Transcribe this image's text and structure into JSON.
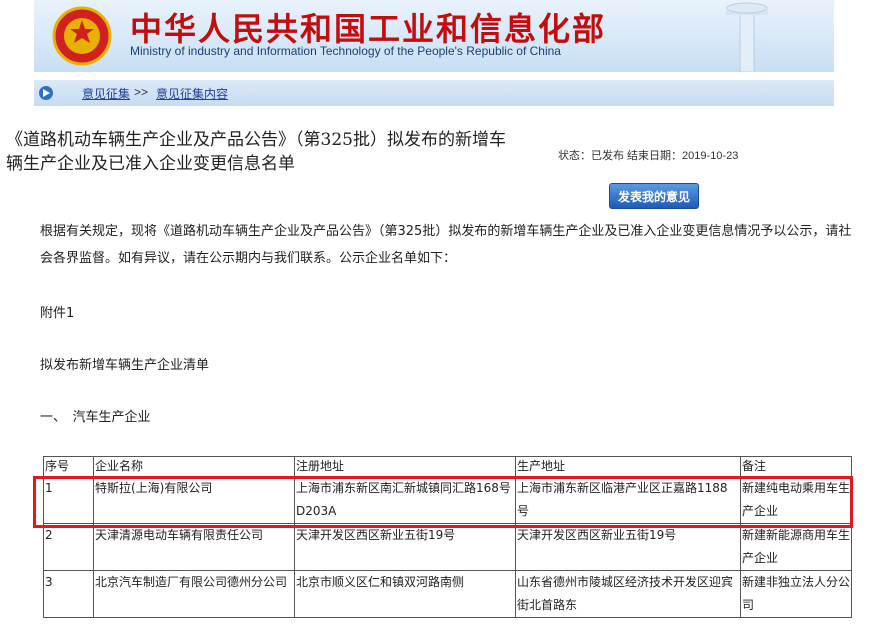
{
  "header": {
    "title": "中华人民共和国工业和信息化部",
    "subtitle": "Ministry of industry and Information Technology of the People's Republic of China"
  },
  "breadcrumb": {
    "item1": "意见征集",
    "separator": ">>",
    "item2": "意见征集内容"
  },
  "article": {
    "title": "《道路机动车辆生产企业及产品公告》（第325批）拟发布的新增车辆生产企业及已准入企业变更信息名单",
    "status": "状态：已发布 结束日期：2019-10-23",
    "comment_button": "发表我的意见",
    "intro": "根据有关规定，现将《道路机动车辆生产企业及产品公告》（第325批）拟发布的新增车辆生产企业及已准入企业变更信息情况予以公示，请社会各界监督。如有异议，请在公示期内与我们联系。公示企业名单如下：",
    "attachment": "附件1",
    "list_title": "拟发布新增车辆生产企业清单",
    "section": "一、　汽车生产企业"
  },
  "table": {
    "headers": [
      "序号",
      "企业名称",
      "注册地址",
      "生产地址",
      "备注"
    ],
    "rows": [
      [
        "1",
        "特斯拉(上海)有限公司",
        "上海市浦东新区南汇新城镇同汇路168号D203A",
        "上海市浦东新区临港产业区正嘉路1188号",
        "新建纯电动乘用车生产企业"
      ],
      [
        "2",
        "天津清源电动车辆有限责任公司",
        "天津开发区西区新业五街19号",
        "天津开发区西区新业五街19号",
        "新建新能源商用车生产企业"
      ],
      [
        "3",
        "北京汽车制造厂有限公司德州分公司",
        "北京市顺义区仁和镇双河路南侧",
        "山东省德州市陵城区经济技术开发区迎宾街北首路东",
        "新建非独立法人分公司"
      ]
    ]
  },
  "colors": {
    "title_red": "#c30d0d",
    "highlight": "#e01a1a",
    "link_blue": "#1f3f9a"
  }
}
